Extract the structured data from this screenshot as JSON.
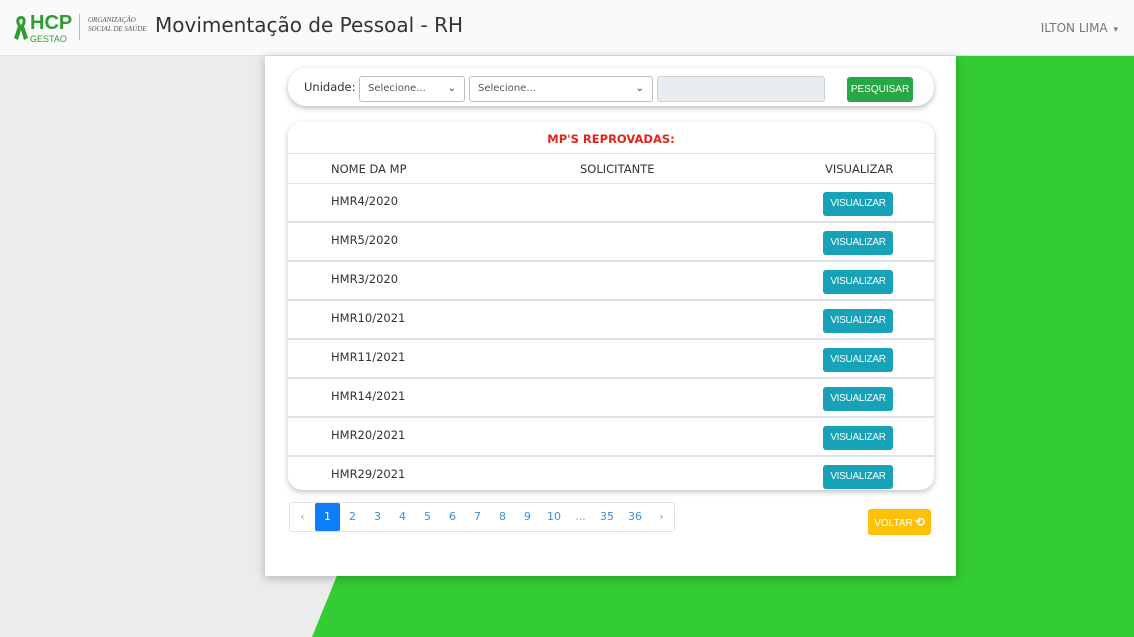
{
  "colors": {
    "background": "#ececec",
    "green": "#33cc33",
    "search_button": "#28a745",
    "view_button": "#17a2b8",
    "back_button": "#ffc107",
    "title_red": "#e0251b",
    "active_page": "#0d7ef7"
  },
  "header": {
    "logo_main": "HCP",
    "logo_sub": "GESTAO",
    "logo_org_line1": "ORGANIZAÇÃO",
    "logo_org_line2": "SOCIAL DE SAÚDE",
    "title": "Movimentação de Pessoal - RH",
    "user": "ILTON LIMA",
    "user_caret_icon": "caret-down-icon"
  },
  "search": {
    "unit_label": "Unidade:",
    "select1_value": "Selecione...",
    "select2_value": "Selecione...",
    "text_value": "",
    "search_button": "PESQUISAR"
  },
  "table": {
    "title": "MP'S REPROVADAS:",
    "columns": [
      "NOME DA MP",
      "SOLICITANTE",
      "VISUALIZAR"
    ],
    "rows": [
      {
        "name": "HMR4/2020",
        "requester": "",
        "action": "VISUALIZAR"
      },
      {
        "name": "HMR5/2020",
        "requester": "",
        "action": "VISUALIZAR"
      },
      {
        "name": "HMR3/2020",
        "requester": "",
        "action": "VISUALIZAR"
      },
      {
        "name": "HMR10/2021",
        "requester": "",
        "action": "VISUALIZAR"
      },
      {
        "name": "HMR11/2021",
        "requester": "",
        "action": "VISUALIZAR"
      },
      {
        "name": "HMR14/2021",
        "requester": "",
        "action": "VISUALIZAR"
      },
      {
        "name": "HMR20/2021",
        "requester": "",
        "action": "VISUALIZAR"
      },
      {
        "name": "HMR29/2021",
        "requester": "",
        "action": "VISUALIZAR"
      }
    ]
  },
  "pagination": {
    "prev": "‹",
    "pages": [
      "1",
      "2",
      "3",
      "4",
      "5",
      "6",
      "7",
      "8",
      "9",
      "10",
      "...",
      "35",
      "36"
    ],
    "next": "›",
    "active": "1"
  },
  "back_button": {
    "label": "VOLTAR",
    "icon": "undo-icon"
  }
}
